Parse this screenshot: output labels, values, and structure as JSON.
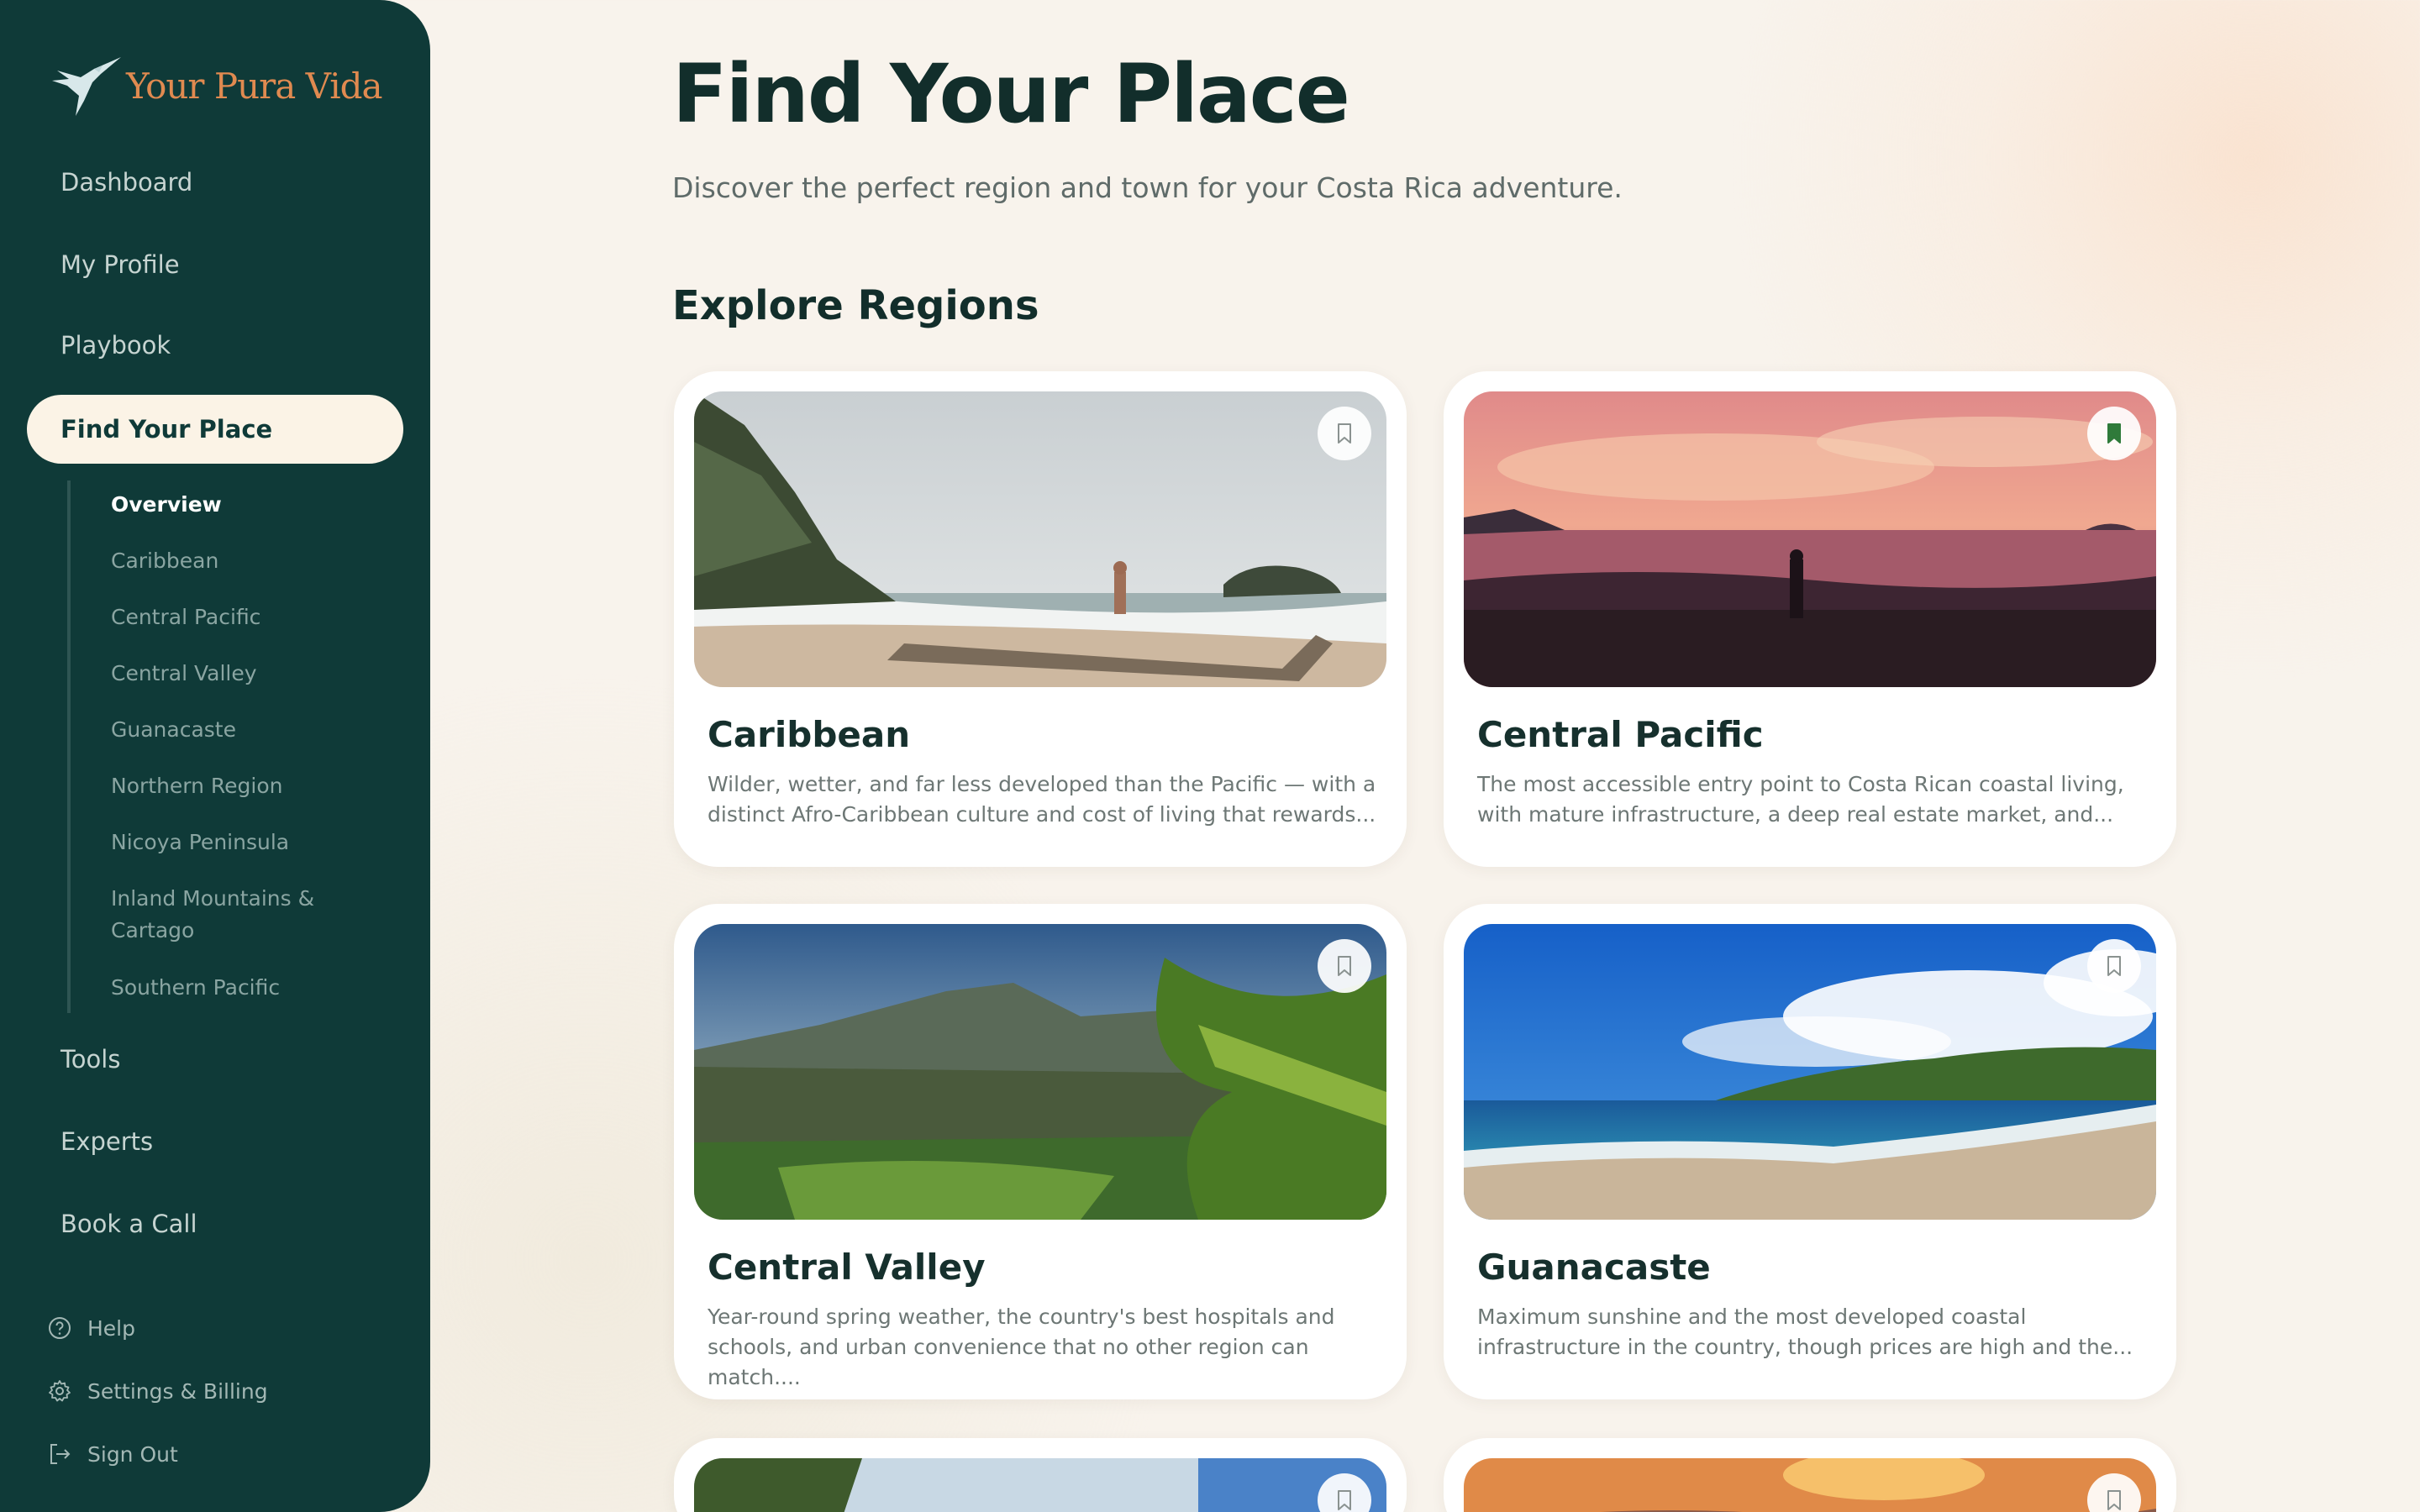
{
  "app": {
    "logo_text": "Your Pura Vida"
  },
  "sidebar": {
    "nav": [
      {
        "label": "Dashboard"
      },
      {
        "label": "My Profile"
      },
      {
        "label": "Playbook"
      },
      {
        "label": "Find Your Place"
      },
      {
        "label": "Tools"
      },
      {
        "label": "Experts"
      },
      {
        "label": "Book a Call"
      }
    ],
    "subnav": [
      {
        "label": "Overview"
      },
      {
        "label": "Caribbean"
      },
      {
        "label": "Central Pacific"
      },
      {
        "label": "Central Valley"
      },
      {
        "label": "Guanacaste"
      },
      {
        "label": "Northern Region"
      },
      {
        "label": "Nicoya Peninsula"
      },
      {
        "label": "Inland Mountains & Cartago"
      },
      {
        "label": "Southern Pacific"
      }
    ],
    "bottom": [
      {
        "label": "Help",
        "icon": "help-circle-icon"
      },
      {
        "label": "Settings & Billing",
        "icon": "gear-icon"
      },
      {
        "label": "Sign Out",
        "icon": "sign-out-icon"
      }
    ],
    "active_item": "Find Your Place",
    "active_subitem": "Overview"
  },
  "main": {
    "title": "Find Your Place",
    "subtitle": "Discover the perfect region and town for your Costa Rica adventure.",
    "section_title": "Explore Regions",
    "regions": [
      {
        "name": "Caribbean",
        "description": "Wilder, wetter, and far less developed than the Pacific — with a distinct Afro-Caribbean culture and cost of living that rewards...",
        "bookmarked": false
      },
      {
        "name": "Central Pacific",
        "description": "The most accessible entry point to Costa Rican coastal living, with mature infrastructure, a deep real estate market, and...",
        "bookmarked": true
      },
      {
        "name": "Central Valley",
        "description": "Year-round spring weather, the country's best hospitals and schools, and urban convenience that no other region can match....",
        "bookmarked": false
      },
      {
        "name": "Guanacaste",
        "description": "Maximum sunshine and the most developed coastal infrastructure in the country, though prices are high and the...",
        "bookmarked": false
      }
    ]
  },
  "colors": {
    "sidebar_bg": "#0f3a38",
    "active_pill": "#fbf3e6",
    "logo_accent": "#e08a50",
    "bookmark_active": "#2f7a3a"
  }
}
